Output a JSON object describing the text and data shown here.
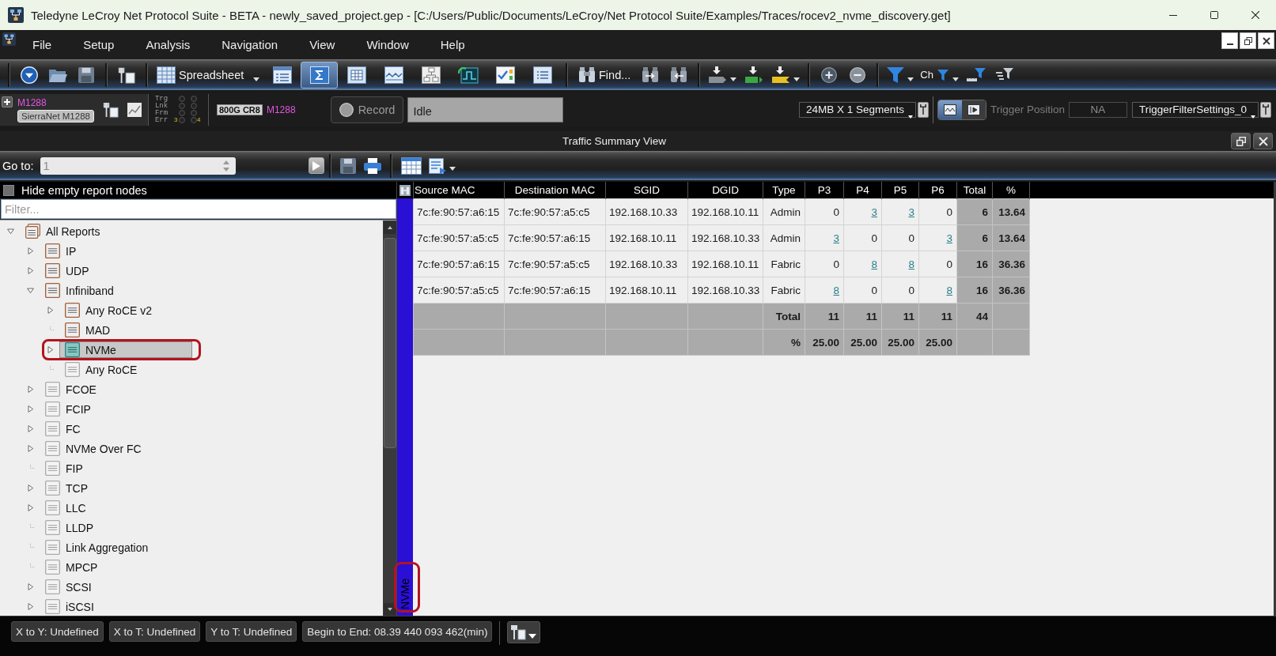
{
  "window": {
    "title": "Teledyne LeCroy Net Protocol Suite - BETA - newly_saved_project.gep - [C:/Users/Public/Documents/LeCroy/Net Protocol Suite/Examples/Traces/rocev2_nvme_discovery.get]"
  },
  "menu": [
    "File",
    "Setup",
    "Analysis",
    "Navigation",
    "View",
    "Window",
    "Help"
  ],
  "toolbar": {
    "view_selector": "Spreadsheet",
    "view_buttons": [
      {
        "selected": false
      },
      {
        "selected": true
      },
      {
        "selected": false
      },
      {
        "selected": false
      },
      {
        "selected": false
      },
      {
        "selected": false
      },
      {
        "selected": false
      },
      {
        "selected": false
      }
    ],
    "find_button": "Find...",
    "channel_filter": "Ch"
  },
  "device": {
    "name": "M1288",
    "button": "SierraNet M1288",
    "indicators": [
      {
        "label": "Trg"
      },
      {
        "label": "Lnk"
      },
      {
        "label": "Frm"
      },
      {
        "label": "Err",
        "tags": [
          "3",
          "4"
        ]
      }
    ],
    "port_speed": "800G CR8",
    "port_device": "M1288",
    "record_button": "Record",
    "status": "Idle",
    "buffer": "24MB X 1 Segments",
    "capture_buttons": [
      {
        "selected": true
      },
      {
        "selected": false
      }
    ],
    "trigger_position": {
      "label": "Trigger Position",
      "value": "NA"
    },
    "trigger_filter": "TriggerFilterSettings_0"
  },
  "panel": {
    "title": "Traffic Summary View"
  },
  "goto": {
    "label": "Go to:",
    "value": "1"
  },
  "report_tree": {
    "hide_empty": {
      "label": "Hide empty report nodes",
      "checked": false
    },
    "filter": {
      "placeholder": "Filter..."
    },
    "items": [
      {
        "label": "All Reports",
        "kind": "branch",
        "expanded": true,
        "empty": false,
        "selected": false,
        "highlighted": false,
        "children": [
          {
            "label": "IP",
            "kind": "branch",
            "expanded": false,
            "empty": false,
            "selected": false,
            "highlighted": false
          },
          {
            "label": "UDP",
            "kind": "branch",
            "expanded": false,
            "empty": false,
            "selected": false,
            "highlighted": false
          },
          {
            "label": "Infiniband",
            "kind": "branch",
            "expanded": true,
            "empty": false,
            "selected": false,
            "highlighted": false,
            "children": [
              {
                "label": "Any RoCE v2",
                "kind": "branch",
                "expanded": false,
                "empty": false,
                "selected": false,
                "highlighted": false
              },
              {
                "label": "MAD",
                "kind": "leaf",
                "empty": false,
                "selected": false,
                "highlighted": false
              },
              {
                "label": "NVMe",
                "kind": "branch",
                "expanded": false,
                "empty": false,
                "selected": true,
                "highlighted": true
              },
              {
                "label": "Any RoCE",
                "kind": "leaf",
                "empty": true,
                "selected": false,
                "highlighted": false
              }
            ]
          },
          {
            "label": "FCOE",
            "kind": "branch",
            "expanded": false,
            "empty": true,
            "selected": false,
            "highlighted": false
          },
          {
            "label": "FCIP",
            "kind": "branch",
            "expanded": false,
            "empty": true,
            "selected": false,
            "highlighted": false
          },
          {
            "label": "FC",
            "kind": "branch",
            "expanded": false,
            "empty": true,
            "selected": false,
            "highlighted": false
          },
          {
            "label": "NVMe Over FC",
            "kind": "branch",
            "expanded": false,
            "empty": true,
            "selected": false,
            "highlighted": false
          },
          {
            "label": "FIP",
            "kind": "leaf",
            "empty": true,
            "selected": false,
            "highlighted": false
          },
          {
            "label": "TCP",
            "kind": "branch",
            "expanded": false,
            "empty": true,
            "selected": false,
            "highlighted": false
          },
          {
            "label": "LLC",
            "kind": "branch",
            "expanded": false,
            "empty": true,
            "selected": false,
            "highlighted": false
          },
          {
            "label": "LLDP",
            "kind": "leaf",
            "empty": true,
            "selected": false,
            "highlighted": false
          },
          {
            "label": "Link Aggregation",
            "kind": "leaf",
            "empty": true,
            "selected": false,
            "highlighted": false
          },
          {
            "label": "MPCP",
            "kind": "leaf",
            "empty": true,
            "selected": false,
            "highlighted": false
          },
          {
            "label": "SCSI",
            "kind": "branch",
            "expanded": false,
            "empty": true,
            "selected": false,
            "highlighted": false
          },
          {
            "label": "iSCSI",
            "kind": "branch",
            "expanded": false,
            "empty": true,
            "selected": false,
            "highlighted": false
          }
        ]
      }
    ]
  },
  "report_tab": {
    "label": "NVMe",
    "highlighted": true
  },
  "table": {
    "columns": [
      "Source MAC",
      "Destination MAC",
      "SGID",
      "DGID",
      "Type",
      "P3",
      "P4",
      "P5",
      "P6",
      "Total",
      "%"
    ],
    "rows": [
      {
        "cells": [
          "7c:fe:90:57:a6:15",
          "7c:fe:90:57:a5:c5",
          "192.168.10.33",
          "192.168.10.11",
          "Admin"
        ],
        "ports": [
          {
            "value": "0",
            "link": false
          },
          {
            "value": "3",
            "link": true
          },
          {
            "value": "3",
            "link": true
          },
          {
            "value": "0",
            "link": false
          }
        ],
        "total": "6",
        "percent": "13.64"
      },
      {
        "cells": [
          "7c:fe:90:57:a5:c5",
          "7c:fe:90:57:a6:15",
          "192.168.10.11",
          "192.168.10.33",
          "Admin"
        ],
        "ports": [
          {
            "value": "3",
            "link": true
          },
          {
            "value": "0",
            "link": false
          },
          {
            "value": "0",
            "link": false
          },
          {
            "value": "3",
            "link": true
          }
        ],
        "total": "6",
        "percent": "13.64"
      },
      {
        "cells": [
          "7c:fe:90:57:a6:15",
          "7c:fe:90:57:a5:c5",
          "192.168.10.33",
          "192.168.10.11",
          "Fabric"
        ],
        "ports": [
          {
            "value": "0",
            "link": false
          },
          {
            "value": "8",
            "link": true
          },
          {
            "value": "8",
            "link": true
          },
          {
            "value": "0",
            "link": false
          }
        ],
        "total": "16",
        "percent": "36.36"
      },
      {
        "cells": [
          "7c:fe:90:57:a5:c5",
          "7c:fe:90:57:a6:15",
          "192.168.10.11",
          "192.168.10.33",
          "Fabric"
        ],
        "ports": [
          {
            "value": "8",
            "link": true
          },
          {
            "value": "0",
            "link": false
          },
          {
            "value": "0",
            "link": false
          },
          {
            "value": "8",
            "link": true
          }
        ],
        "total": "16",
        "percent": "36.36"
      }
    ],
    "footer": [
      {
        "label": "Total",
        "ports": [
          "11",
          "11",
          "11",
          "11"
        ],
        "total": "44"
      },
      {
        "label": "%",
        "ports": [
          "25.00",
          "25.00",
          "25.00",
          "25.00"
        ]
      }
    ]
  },
  "status_bar": {
    "items": [
      "X to Y: Undefined",
      "X to T: Undefined",
      "Y to T: Undefined",
      "Begin to End: 08.39 440 093 462(min)"
    ]
  }
}
